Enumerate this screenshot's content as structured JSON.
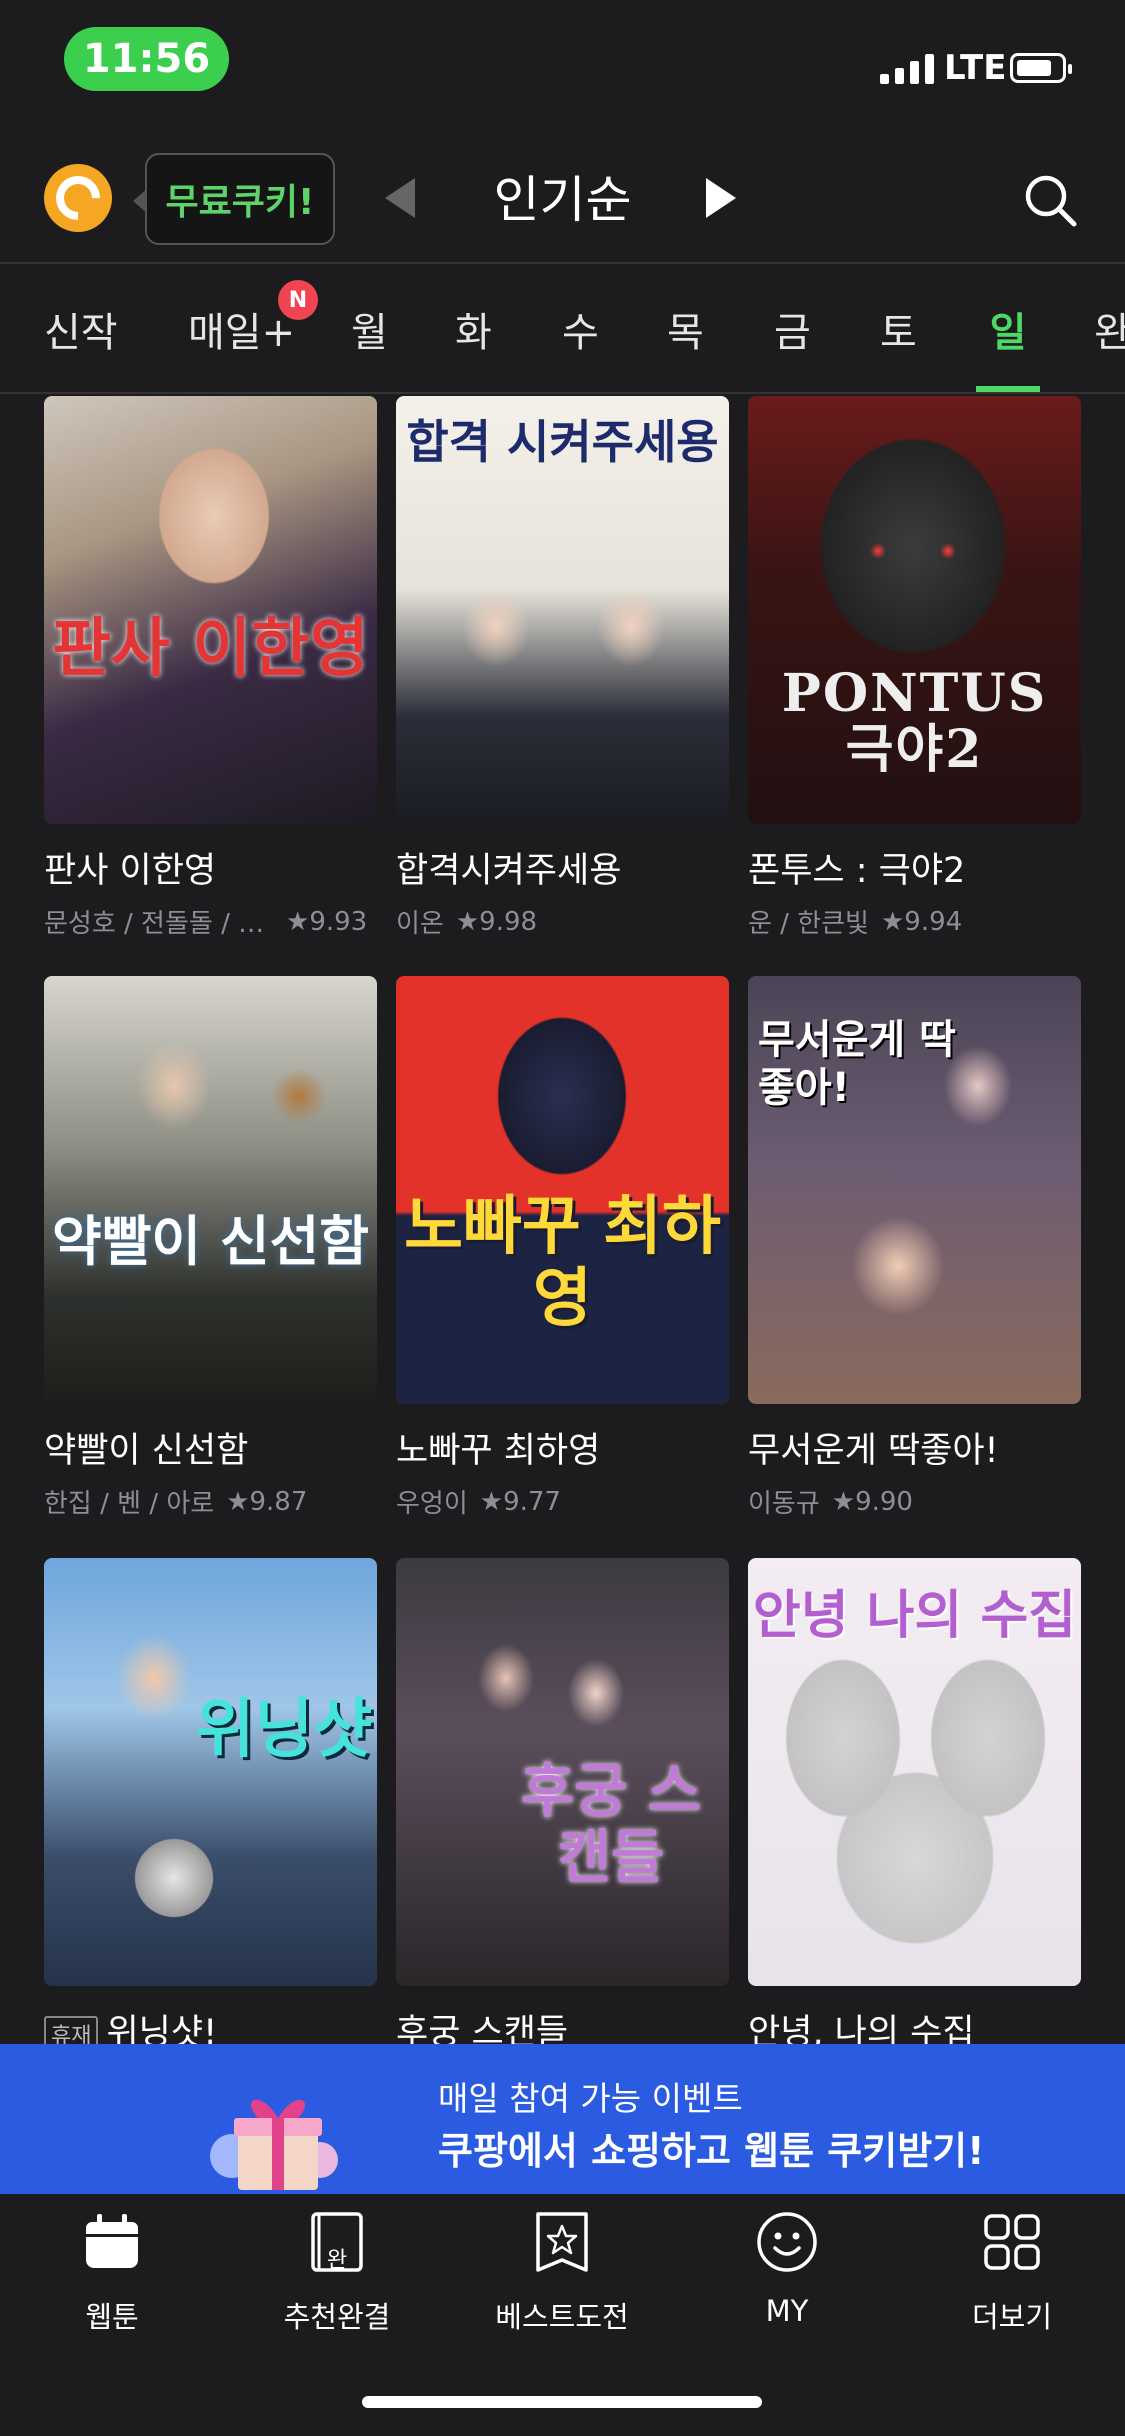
{
  "status": {
    "time": "11:56",
    "network": "LTE"
  },
  "header": {
    "cookie_label": "무료쿠키!",
    "sort_title": "인기순"
  },
  "tabs": {
    "items": [
      "신작",
      "매일+",
      "월",
      "화",
      "수",
      "목",
      "금",
      "토",
      "일",
      "완"
    ],
    "active": "일",
    "badge": "N"
  },
  "comics": [
    {
      "title": "판사 이한영",
      "author": "문성호 / 전돌돌 / 이…",
      "rating": "9.93",
      "cover_text": "판사 이한영"
    },
    {
      "title": "합격시켜주세용",
      "author": "이온",
      "rating": "9.98",
      "cover_text": "합격 시켜주세용"
    },
    {
      "title": "폰투스 : 극야2",
      "author": "운 / 한큰빛",
      "rating": "9.94",
      "cover_text": "PONTUS 극야2"
    },
    {
      "title": "약빨이 신선함",
      "author": "한집 / 벤 / 아로",
      "rating": "9.87",
      "cover_text": "약빨이 신선함"
    },
    {
      "title": "노빠꾸 최하영",
      "author": "우엉이",
      "rating": "9.77",
      "cover_text": "노빠꾸 최하영"
    },
    {
      "title": "무서운게 딱좋아!",
      "author": "이동규",
      "rating": "9.90",
      "cover_text": "무서운게 딱좋아!"
    },
    {
      "title": "위닝샷!",
      "author": "",
      "rating": "",
      "badge": "휴재",
      "cover_text": "위닝샷"
    },
    {
      "title": "후궁 스캔들",
      "author": "",
      "rating": "",
      "cover_text": "후궁 스캔들"
    },
    {
      "title": "안녕, 나의 수집",
      "author": "",
      "rating": "",
      "cover_text": "안녕 나의 수집"
    }
  ],
  "banner": {
    "line1": "매일 참여 가능 이벤트",
    "line2": "쿠팡에서 쇼핑하고 웹툰 쿠키받기!"
  },
  "nav": [
    {
      "label": "웹툰",
      "icon": "calendar-icon"
    },
    {
      "label": "추천완결",
      "icon": "book-icon",
      "glyph": "완"
    },
    {
      "label": "베스트도전",
      "icon": "star-box-icon"
    },
    {
      "label": "MY",
      "icon": "smile-icon"
    },
    {
      "label": "더보기",
      "icon": "grid-icon"
    }
  ],
  "colors": {
    "accent": "#4cd964",
    "background": "#1c1c1e",
    "banner": "#2a5be0",
    "badge": "#f04452"
  }
}
